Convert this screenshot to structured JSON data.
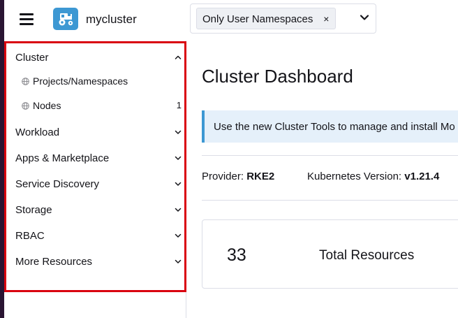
{
  "header": {
    "menu_icon": "hamburger-menu-icon",
    "logo_icon": "cluster-tractor-icon",
    "cluster_name": "mycluster",
    "namespace_filter": {
      "selected": "Only User Namespaces",
      "remove_icon": "×",
      "dropdown_icon": "chevron-down-icon"
    }
  },
  "sidebar": {
    "groups": [
      {
        "label": "Cluster",
        "expanded": true,
        "children": [
          {
            "label": "Projects/Namespaces",
            "count": ""
          },
          {
            "label": "Nodes",
            "count": "1"
          }
        ]
      },
      {
        "label": "Workload",
        "expanded": false
      },
      {
        "label": "Apps & Marketplace",
        "expanded": false
      },
      {
        "label": "Service Discovery",
        "expanded": false
      },
      {
        "label": "Storage",
        "expanded": false
      },
      {
        "label": "RBAC",
        "expanded": false
      },
      {
        "label": "More Resources",
        "expanded": false
      }
    ]
  },
  "main": {
    "title": "Cluster Dashboard",
    "banner": "Use the new Cluster Tools to manage and install Mo",
    "provider_label": "Provider:",
    "provider_value": "RKE2",
    "k8s_version_label": "Kubernetes Version:",
    "k8s_version_value": "v1.21.4",
    "resources": {
      "count": "33",
      "label": "Total Resources"
    }
  },
  "colors": {
    "accent": "#3d98d3",
    "highlight_border": "#d9000f",
    "banner_bg": "#e5f0fa",
    "text": "#141419",
    "border": "#dcdee7"
  }
}
